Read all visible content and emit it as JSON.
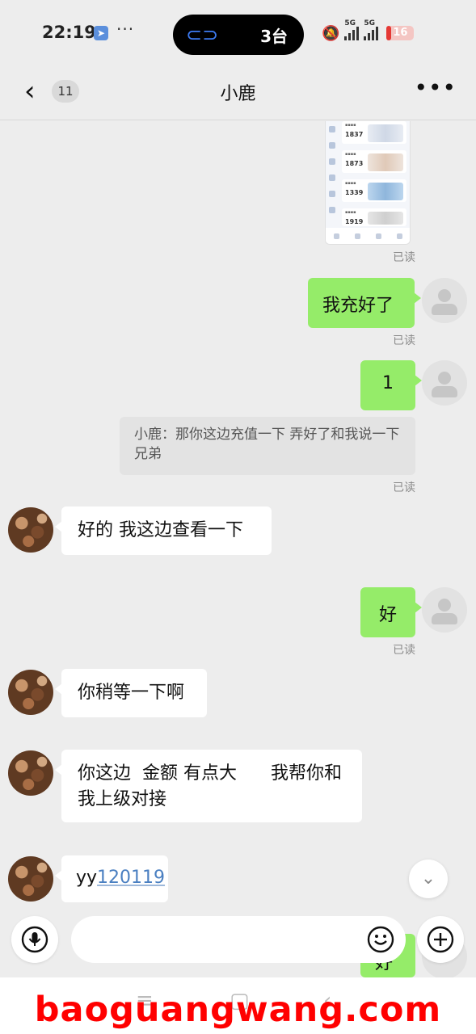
{
  "status_bar": {
    "time": "22:19",
    "island_text": "3台",
    "network_1": "5G",
    "network_2": "5G",
    "battery": "16",
    "battery_level_percent": 16,
    "battery_color": "#e53935"
  },
  "header": {
    "back_icon": "chevron-left-icon",
    "unread_count": "11",
    "title": "小鹿",
    "more_icon": "more-dots-icon"
  },
  "shared_image": {
    "cards": [
      {
        "number": "1837"
      },
      {
        "number": "1873"
      },
      {
        "number": "1339"
      },
      {
        "number": "1919"
      }
    ]
  },
  "messages": {
    "read_label": "已读",
    "me_1": "我充好了",
    "me_2": "1",
    "quote": "小鹿：那你这边充值一下  弄好了和我说一下兄弟",
    "him_1": "好的 我这边查看一下",
    "me_3": "好",
    "him_2": "你稍等一下啊",
    "him_3": "你这边  金额 有点大      我帮你和我上级对接",
    "him_4_prefix": "yy",
    "him_4_link": "120119",
    "partial_me": "好"
  },
  "composer": {
    "input_value": "",
    "voice_icon": "microphone-icon",
    "emoji_icon": "smile-icon",
    "plus_icon": "plus-circle-icon",
    "scroll_icon": "chevron-down-icon"
  },
  "colors": {
    "me_bubble": "#95ec69",
    "background": "#ededed",
    "link": "#4a7fc1",
    "watermark": "#ff0000"
  },
  "watermark": "baoguangwang.com"
}
